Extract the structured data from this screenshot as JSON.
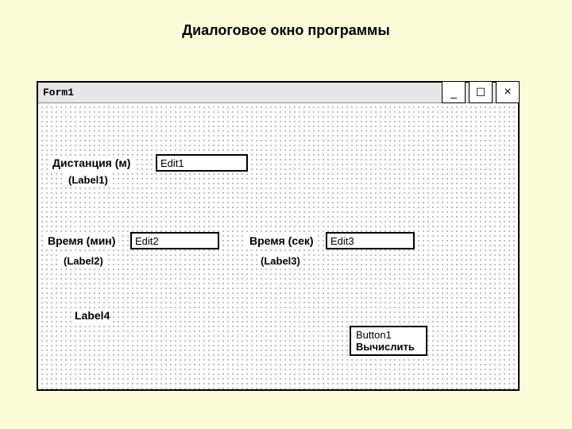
{
  "heading": "Диалоговое окно программы",
  "window": {
    "title": "Form1",
    "buttons": {
      "min": "_",
      "max": "☐",
      "close": "×"
    }
  },
  "labels": {
    "distance": "Дистанция (м)",
    "distance_sub": "(Label1)",
    "time_min": "Время (мин)",
    "time_min_sub": "(Label2)",
    "time_sec": "Время (сек)",
    "time_sec_sub": "(Label3)",
    "label4": "Label4"
  },
  "edits": {
    "edit1": "Edit1",
    "edit2": "Edit2",
    "edit3": "Edit3"
  },
  "button1": {
    "name": "Button1",
    "label": "Вычислить"
  }
}
